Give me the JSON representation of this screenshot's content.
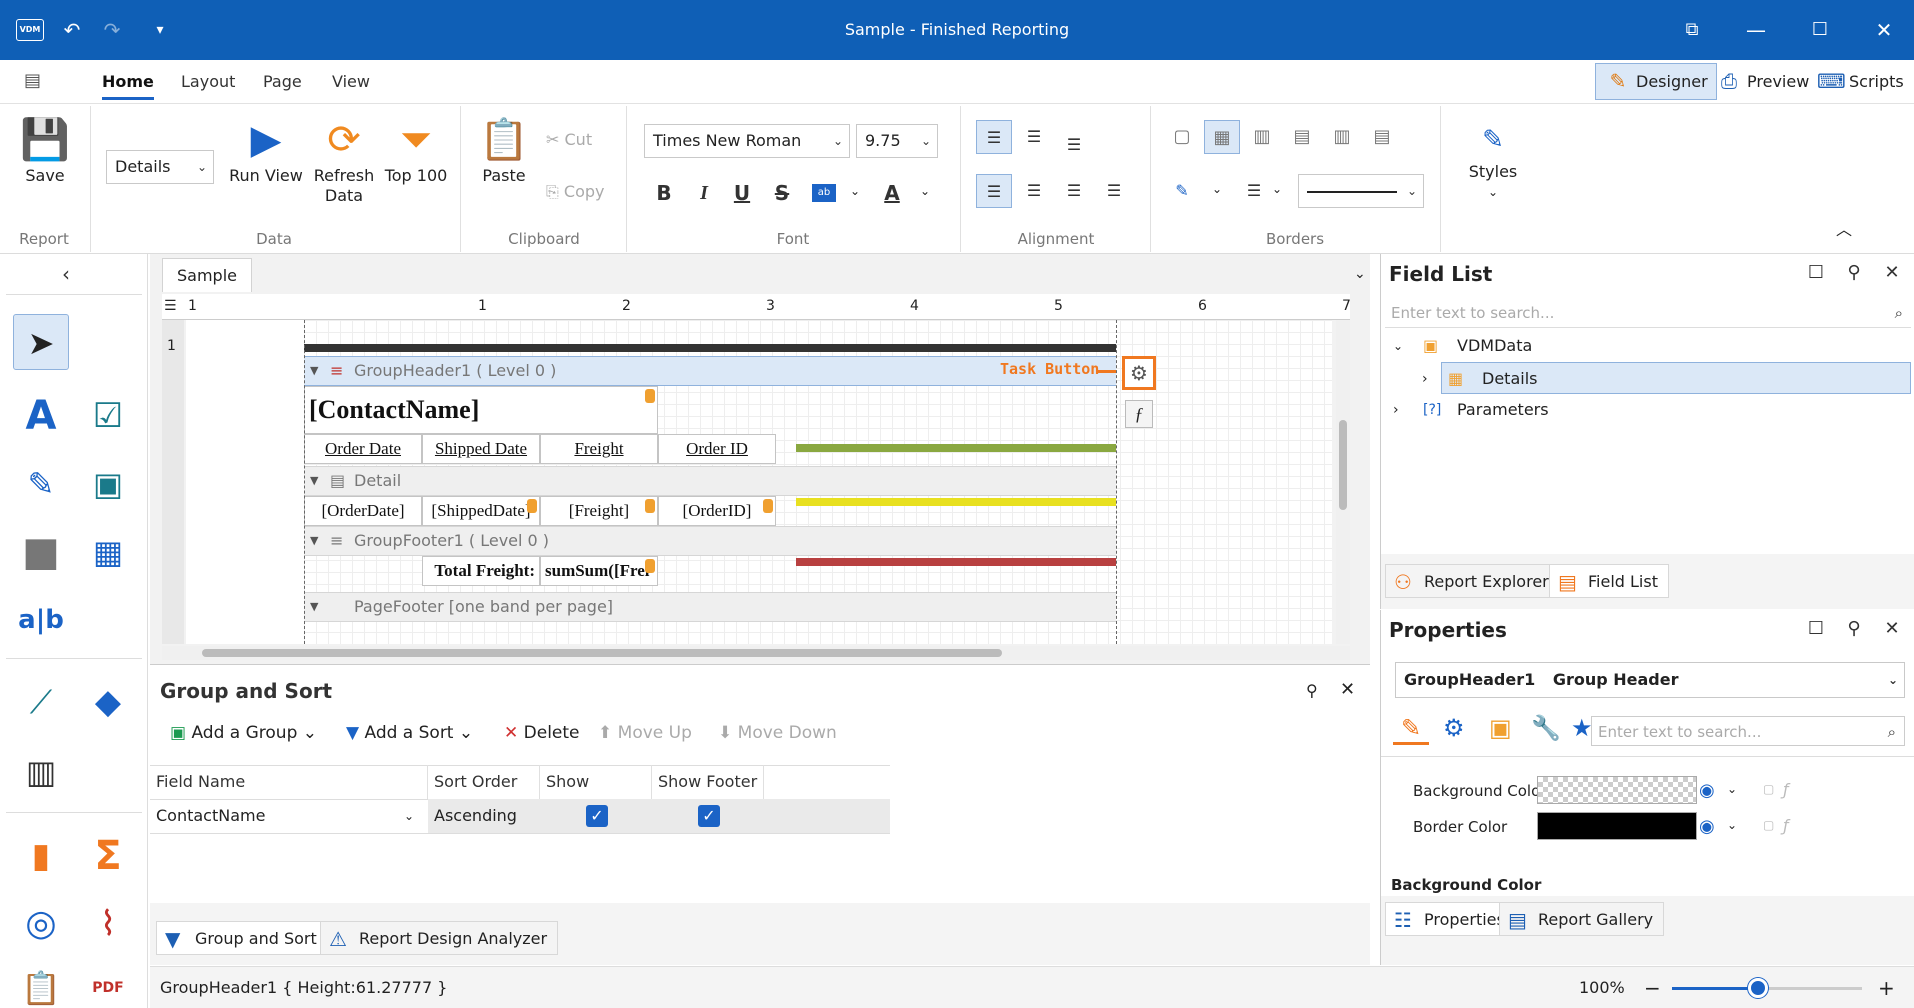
{
  "window": {
    "title": "Sample - Finished Reporting",
    "logo": "VDM"
  },
  "ribbon_tabs": [
    "Home",
    "Layout",
    "Page",
    "View"
  ],
  "modes": {
    "designer": "Designer",
    "preview": "Preview",
    "scripts": "Scripts"
  },
  "ribbon": {
    "report": {
      "save": "Save",
      "group": "Report"
    },
    "data": {
      "band_combo": "Details",
      "run_view": "Run View",
      "refresh_data_1": "Refresh",
      "refresh_data_2": "Data",
      "top_100": "Top 100",
      "group": "Data"
    },
    "clipboard": {
      "paste": "Paste",
      "cut": "Cut",
      "copy": "Copy",
      "group": "Clipboard"
    },
    "font": {
      "family": "Times New Roman",
      "size": "9.75",
      "bold": "B",
      "italic": "I",
      "underline": "U",
      "strike": "S",
      "highlight": "ab",
      "color": "A",
      "group": "Font"
    },
    "alignment": {
      "group": "Alignment"
    },
    "borders": {
      "group": "Borders"
    },
    "styles": {
      "label": "Styles"
    }
  },
  "document": {
    "tab": "Sample",
    "ruler_ticks": [
      "1",
      "1",
      "2",
      "3",
      "4",
      "5",
      "6",
      "7"
    ]
  },
  "report": {
    "group_header": "GroupHeader1 ( Level 0 )",
    "task_button_label": "Task Button",
    "contact_name": "[ContactName]",
    "headers": [
      "Order Date",
      "Shipped Date",
      "Freight",
      "Order ID"
    ],
    "detail_band": "Detail",
    "detail_cells": [
      "[OrderDate]",
      "[ShippedDate]",
      "[Freight]",
      "[OrderID]"
    ],
    "group_footer": "GroupFooter1 ( Level 0 )",
    "total_label": "Total Freight:",
    "total_value": "sumSum([Frei",
    "page_footer": "PageFooter [one band per page]",
    "vruler_num": "1"
  },
  "group_sort": {
    "title": "Group and Sort",
    "add_group": "Add a Group",
    "add_sort": "Add a Sort",
    "delete": "Delete",
    "move_up": "Move Up",
    "move_down": "Move Down",
    "columns": [
      "Field Name",
      "Sort Order",
      "Show Header",
      "Show Footer"
    ],
    "row": {
      "field": "ContactName",
      "order": "Ascending",
      "show_header": true,
      "show_footer": true
    },
    "tabs": [
      "Group and Sort",
      "Report Design Analyzer"
    ]
  },
  "status": {
    "text": "GroupHeader1 { Height:61.27777 }",
    "zoom": "100%"
  },
  "field_list": {
    "title": "Field List",
    "search_placeholder": "Enter text to search...",
    "items": [
      "VDMData",
      "Details",
      "Parameters"
    ],
    "tabs": [
      "Report Explorer",
      "Field List"
    ]
  },
  "properties": {
    "title": "Properties",
    "selected_name": "GroupHeader1",
    "selected_type": "Group Header",
    "search_placeholder": "Enter text to search...",
    "rows": [
      {
        "label": "Background Color"
      },
      {
        "label": "Border Color"
      }
    ],
    "section": "Background Color",
    "tabs": [
      "Properties",
      "Report Gallery"
    ]
  }
}
